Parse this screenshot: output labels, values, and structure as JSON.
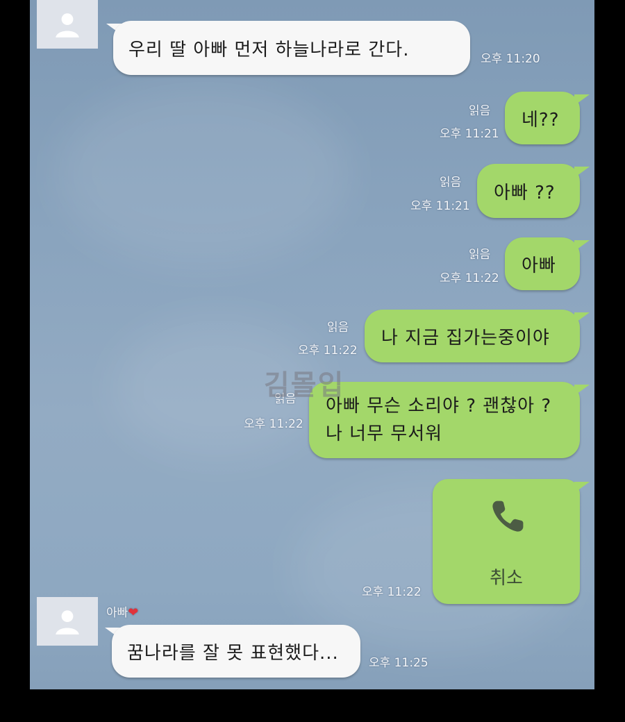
{
  "chat": {
    "sender_name": "아빠",
    "messages": [
      {
        "text": "우리 딸 아빠 먼저 하늘나라로 간다.",
        "time": "오후 11:20"
      },
      {
        "text": "네??",
        "time": "오후 11:21",
        "read": "읽음"
      },
      {
        "text": "아빠 ??",
        "time": "오후 11:21",
        "read": "읽음"
      },
      {
        "text": "아빠",
        "time": "오후 11:22",
        "read": "읽음"
      },
      {
        "text": "나 지금 집가는중이야",
        "time": "오후 11:22",
        "read": "읽음"
      },
      {
        "line1": "아빠 무슨 소리야 ? 괜찮아 ?",
        "line2": "나 너무 무서워",
        "time": "오후 11:22",
        "read": "읽음"
      },
      {
        "text": "꿈나라를 잘 못 표현했다...",
        "time": "오후 11:25"
      }
    ],
    "call": {
      "label": "취소",
      "time": "오후 11:22",
      "icon": "phone-icon"
    }
  },
  "watermark": "김몰입",
  "colors": {
    "my_bubble": "#a3d76a",
    "their_bubble": "#f7f7f7",
    "background": "#8aa4be",
    "heart": "#e0323b"
  }
}
